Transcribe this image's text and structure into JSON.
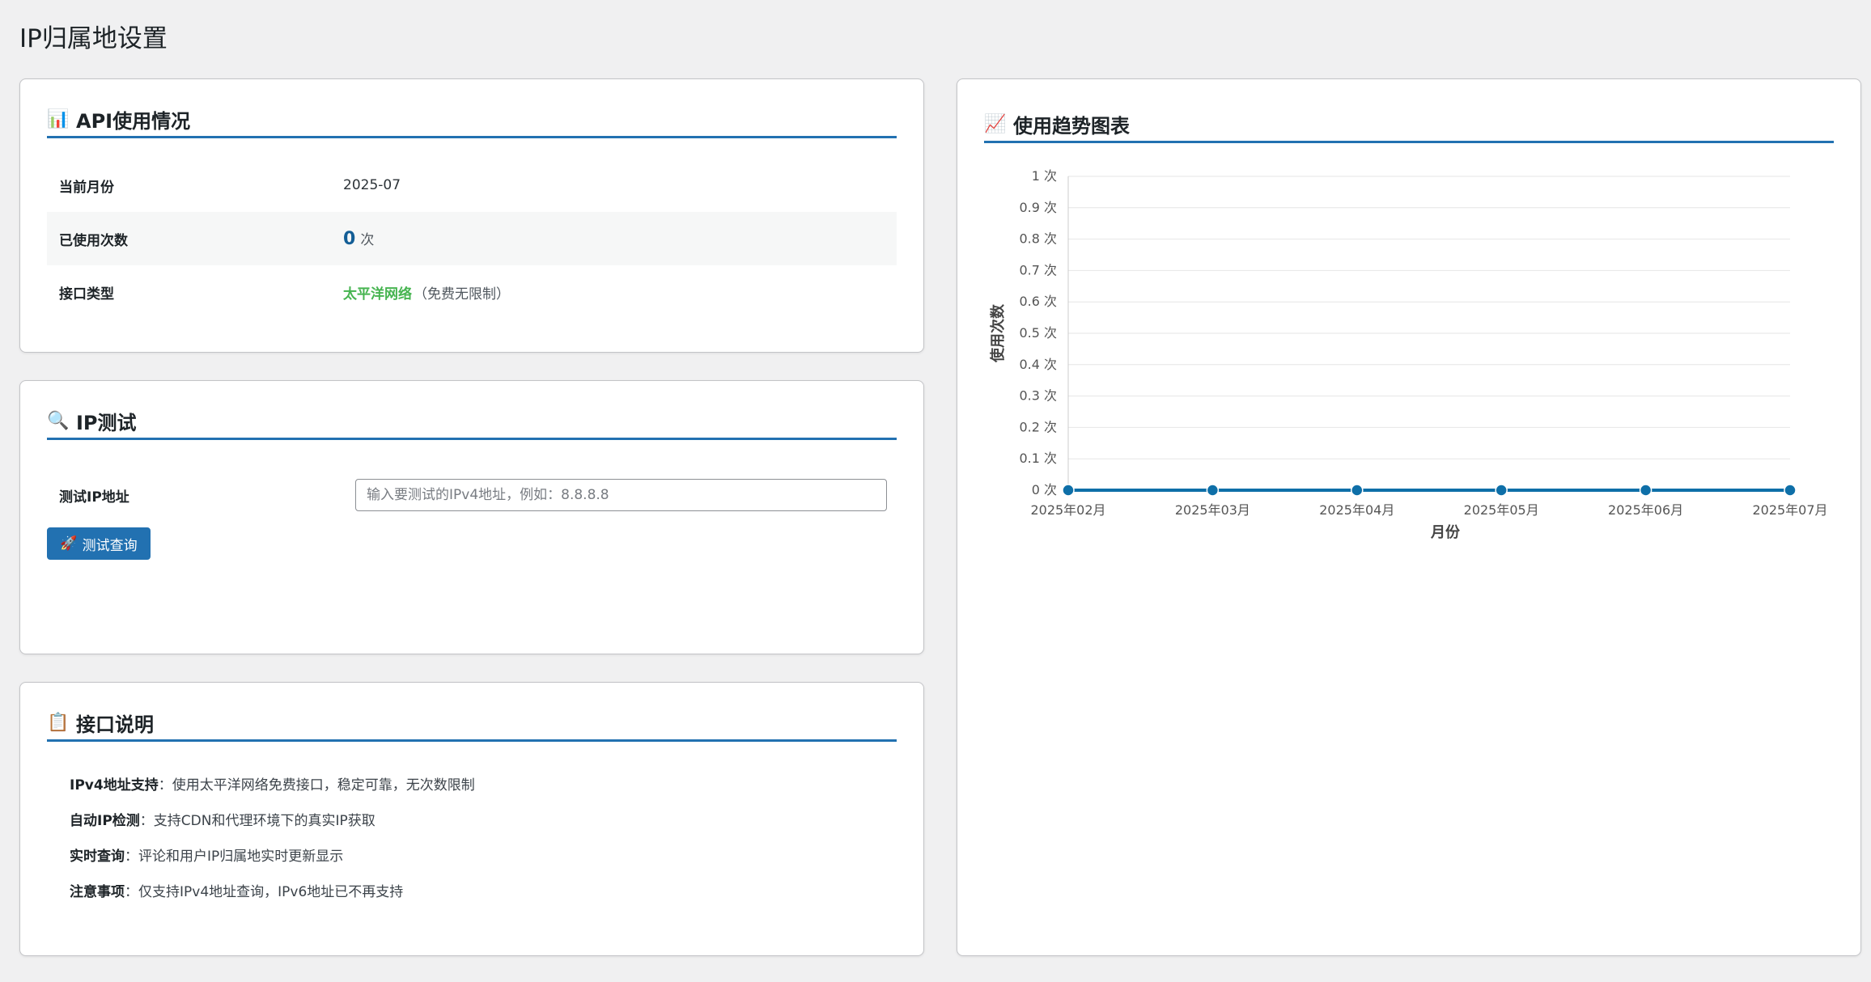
{
  "page": {
    "title": "IP归属地设置"
  },
  "api_usage": {
    "heading": "API使用情况",
    "icon": "bar-chart-icon",
    "rows": [
      {
        "label": "当前月份",
        "value": "2025-07"
      },
      {
        "label": "已使用次数",
        "count": "0",
        "unit": "次"
      },
      {
        "label": "接口类型",
        "api_name": "太平洋网络",
        "api_note": "（免费无限制）"
      }
    ]
  },
  "ip_test": {
    "heading": "IP测试",
    "icon": "magnifier-icon",
    "field_label": "测试IP地址",
    "input_value": "",
    "input_placeholder": "输入要测试的IPv4地址，例如：8.8.8.8",
    "button_label": "测试查询"
  },
  "doc": {
    "heading": "接口说明",
    "icon": "clipboard-icon",
    "items": [
      {
        "title": "IPv4地址支持",
        "text": "：使用太平洋网络免费接口，稳定可靠，无次数限制"
      },
      {
        "title": "自动IP检测",
        "text": "：支持CDN和代理环境下的真实IP获取"
      },
      {
        "title": "实时查询",
        "text": "：评论和用户IP归属地实时更新显示"
      },
      {
        "title": "注意事项",
        "text": "：仅支持IPv4地址查询，IPv6地址已不再支持"
      }
    ]
  },
  "chart_card": {
    "heading": "使用趋势图表",
    "icon": "trend-up-icon"
  },
  "colors": {
    "accent": "#2271b1",
    "line": "#0e6fa8",
    "grid": "#e6e6e6",
    "green": "#46b450"
  },
  "chart_data": {
    "type": "line",
    "categories": [
      "2025年02月",
      "2025年03月",
      "2025年04月",
      "2025年05月",
      "2025年06月",
      "2025年07月"
    ],
    "series": [
      {
        "values": [
          0,
          0,
          0,
          0,
          0,
          0
        ]
      }
    ],
    "xlabel": "月份",
    "ylabel": "使用次数",
    "ylim": [
      0,
      1
    ],
    "yticks": [
      "0 次",
      "0.1 次",
      "0.2 次",
      "0.3 次",
      "0.4 次",
      "0.5 次",
      "0.6 次",
      "0.7 次",
      "0.8 次",
      "0.9 次",
      "1 次"
    ],
    "ytick_values": [
      0,
      0.1,
      0.2,
      0.3,
      0.4,
      0.5,
      0.6,
      0.7,
      0.8,
      0.9,
      1
    ],
    "grid": true,
    "legend": "none"
  }
}
